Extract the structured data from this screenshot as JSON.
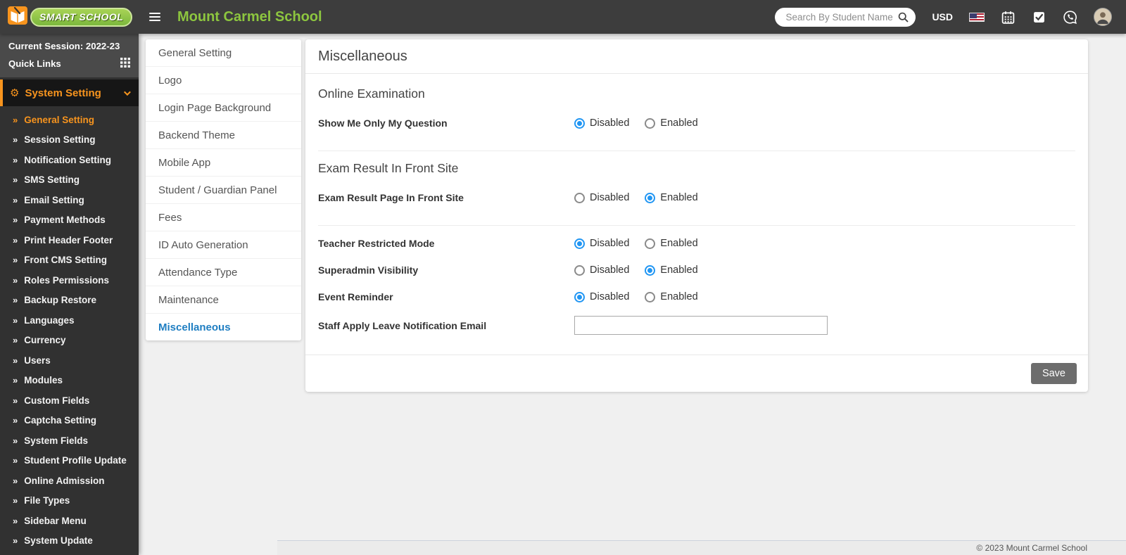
{
  "colors": {
    "accent_orange": "#f7941e",
    "brand_green": "#8dc63f",
    "active_blue": "#1f7ec2",
    "radio_blue": "#2196f3",
    "header_dark": "#3d3d3d",
    "sidebar_dark": "#313131"
  },
  "glyphs": {
    "item_chevron": "»",
    "gear": "⚙"
  },
  "header": {
    "logo_text": "SMART SCHOOL",
    "school_name": "Mount Carmel School",
    "search_placeholder": "Search By Student Name",
    "currency_label": "USD",
    "icons": [
      "hamburger-icon",
      "search-icon",
      "us-flag-icon",
      "calendar-icon",
      "task-check-icon",
      "whatsapp-icon",
      "avatar"
    ]
  },
  "sidebar": {
    "session_label": "Current Session: 2022-23",
    "quick_links_label": "Quick Links",
    "menu_title": "System Setting",
    "active_item": "General Setting",
    "items": [
      "General Setting",
      "Session Setting",
      "Notification Setting",
      "SMS Setting",
      "Email Setting",
      "Payment Methods",
      "Print Header Footer",
      "Front CMS Setting",
      "Roles Permissions",
      "Backup Restore",
      "Languages",
      "Currency",
      "Users",
      "Modules",
      "Custom Fields",
      "Captcha Setting",
      "System Fields",
      "Student Profile Update",
      "Online Admission",
      "File Types",
      "Sidebar Menu",
      "System Update"
    ]
  },
  "subnav": {
    "active_item": "Miscellaneous",
    "items": [
      "General Setting",
      "Logo",
      "Login Page Background",
      "Backend Theme",
      "Mobile App",
      "Student / Guardian Panel",
      "Fees",
      "ID Auto Generation",
      "Attendance Type",
      "Maintenance",
      "Miscellaneous"
    ]
  },
  "main": {
    "title": "Miscellaneous",
    "sections": {
      "online_exam_title": "Online Examination",
      "exam_result_title": "Exam Result In Front Site"
    },
    "radio_options": [
      "Disabled",
      "Enabled"
    ],
    "rows": [
      {
        "label": "Show Me Only My Question",
        "selected": "Disabled"
      },
      {
        "label": "Exam Result Page In Front Site",
        "selected": "Enabled"
      },
      {
        "label": "Teacher Restricted Mode",
        "selected": "Disabled"
      },
      {
        "label": "Superadmin Visibility",
        "selected": "Enabled"
      },
      {
        "label": "Event Reminder",
        "selected": "Disabled"
      }
    ],
    "email_row": {
      "label": "Staff Apply Leave Notification Email",
      "value": ""
    },
    "save_label": "Save"
  },
  "footer": {
    "copyright": "© 2023 Mount Carmel School"
  }
}
